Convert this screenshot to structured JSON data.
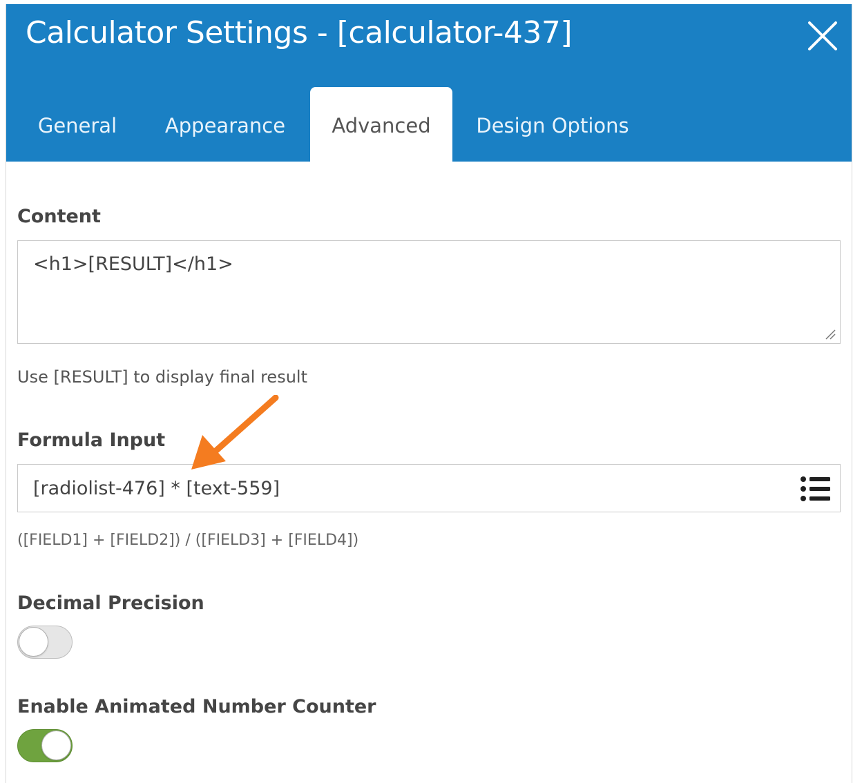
{
  "window": {
    "title": "Calculator Settings - [calculator-437]"
  },
  "tabs": [
    {
      "label": "General",
      "active": false
    },
    {
      "label": "Appearance",
      "active": false
    },
    {
      "label": "Advanced",
      "active": true
    },
    {
      "label": "Design Options",
      "active": false
    }
  ],
  "content": {
    "label": "Content",
    "value": "<h1>[RESULT]</h1>",
    "help": "Use [RESULT] to display final result"
  },
  "formula": {
    "label": "Formula Input",
    "value": "[radiolist-476] * [text-559]",
    "help": "([FIELD1] + [FIELD2]) / ([FIELD3] + [FIELD4])"
  },
  "decimal_precision": {
    "label": "Decimal Precision",
    "enabled": false
  },
  "animated_counter": {
    "label": "Enable Animated Number Counter",
    "enabled": true
  },
  "colors": {
    "header": "#1a80c4",
    "toggle_on": "#6fa33f",
    "annotation_arrow": "#f47c20"
  },
  "icons": {
    "close": "close-icon",
    "field_list": "list-icon",
    "annotation": "arrow-icon"
  }
}
